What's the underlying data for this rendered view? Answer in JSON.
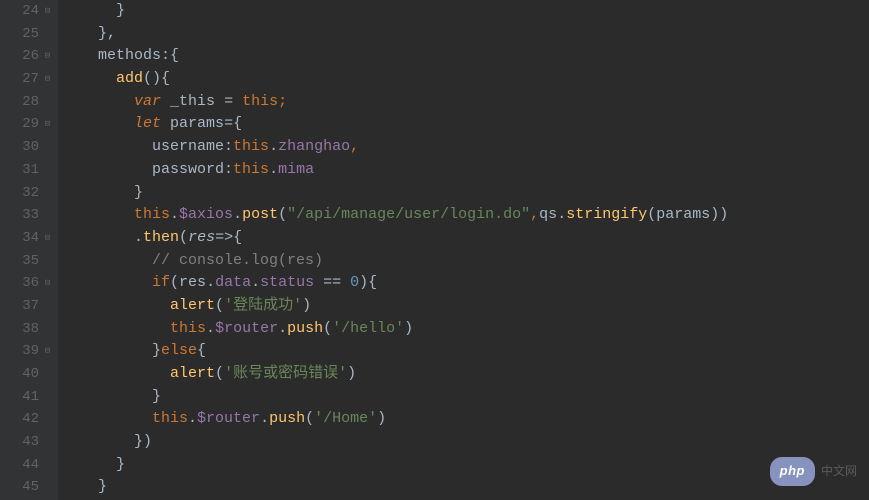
{
  "gutter": {
    "lines": [
      {
        "num": "24",
        "fold": "close"
      },
      {
        "num": "25",
        "fold": ""
      },
      {
        "num": "26",
        "fold": "open"
      },
      {
        "num": "27",
        "fold": "open"
      },
      {
        "num": "28",
        "fold": ""
      },
      {
        "num": "29",
        "fold": "open"
      },
      {
        "num": "30",
        "fold": ""
      },
      {
        "num": "31",
        "fold": ""
      },
      {
        "num": "32",
        "fold": ""
      },
      {
        "num": "33",
        "fold": ""
      },
      {
        "num": "34",
        "fold": "open"
      },
      {
        "num": "35",
        "fold": ""
      },
      {
        "num": "36",
        "fold": "open"
      },
      {
        "num": "37",
        "fold": ""
      },
      {
        "num": "38",
        "fold": ""
      },
      {
        "num": "39",
        "fold": "open"
      },
      {
        "num": "40",
        "fold": ""
      },
      {
        "num": "41",
        "fold": ""
      },
      {
        "num": "42",
        "fold": ""
      },
      {
        "num": "43",
        "fold": ""
      },
      {
        "num": "44",
        "fold": ""
      },
      {
        "num": "45",
        "fold": ""
      }
    ]
  },
  "code": {
    "l24": {
      "brace": "}"
    },
    "l25": {
      "brace": "},",
      "comma": ","
    },
    "l26": {
      "methods": "methods",
      "colon": ":",
      "brace": "{"
    },
    "l27": {
      "add": "add",
      "parens": "()",
      "brace": "{"
    },
    "l28": {
      "var": "var",
      "_this": "_this",
      "eq": " = ",
      "this": "this",
      "semi": ";"
    },
    "l29": {
      "let": "let",
      "params": "params",
      "eq": "=",
      "brace": "{"
    },
    "l30": {
      "username": "username",
      "colon": ":",
      "this": "this",
      "dot": ".",
      "zhanghao": "zhanghao",
      "comma": ","
    },
    "l31": {
      "password": "password",
      "colon": ":",
      "this": "this",
      "dot": ".",
      "mima": "mima"
    },
    "l32": {
      "brace": "}"
    },
    "l33": {
      "this": "this",
      "dot1": ".",
      "axios": "$axios",
      "dot2": ".",
      "post": "post",
      "paren1": "(",
      "url": "\"/api/manage/user/login.do\"",
      "comma": ",",
      "qs": "qs",
      "dot3": ".",
      "stringify": "stringify",
      "paren2": "(",
      "params": "params",
      "paren3": "))"
    },
    "l34": {
      "dot": ".",
      "then": "then",
      "paren": "(",
      "res": "res",
      "arrow": "=>",
      "brace": "{"
    },
    "l35": {
      "comment": "// console.log(res)"
    },
    "l36": {
      "if": "if",
      "paren1": "(",
      "res": "res",
      "dot1": ".",
      "data": "data",
      "dot2": ".",
      "status": "status",
      "eq": " == ",
      "zero": "0",
      "paren2": ")",
      "brace": "{"
    },
    "l37": {
      "alert": "alert",
      "paren1": "(",
      "str": "'登陆成功'",
      "paren2": ")"
    },
    "l38": {
      "this": "this",
      "dot1": ".",
      "router": "$router",
      "dot2": ".",
      "push": "push",
      "paren1": "(",
      "str": "'/hello'",
      "paren2": ")"
    },
    "l39": {
      "brace1": "}",
      "else": "else",
      "brace2": "{"
    },
    "l40": {
      "alert": "alert",
      "paren1": "(",
      "str": "'账号或密码错误'",
      "paren2": ")"
    },
    "l41": {
      "brace": "}"
    },
    "l42": {
      "this": "this",
      "dot1": ".",
      "router": "$router",
      "dot2": ".",
      "push": "push",
      "paren1": "(",
      "str": "'/Home'",
      "paren2": ")"
    },
    "l43": {
      "brace": "})"
    },
    "l44": {
      "brace": "}"
    },
    "l45": {
      "brace": "}"
    }
  },
  "watermark": {
    "badge": "php",
    "text": "中文网"
  }
}
